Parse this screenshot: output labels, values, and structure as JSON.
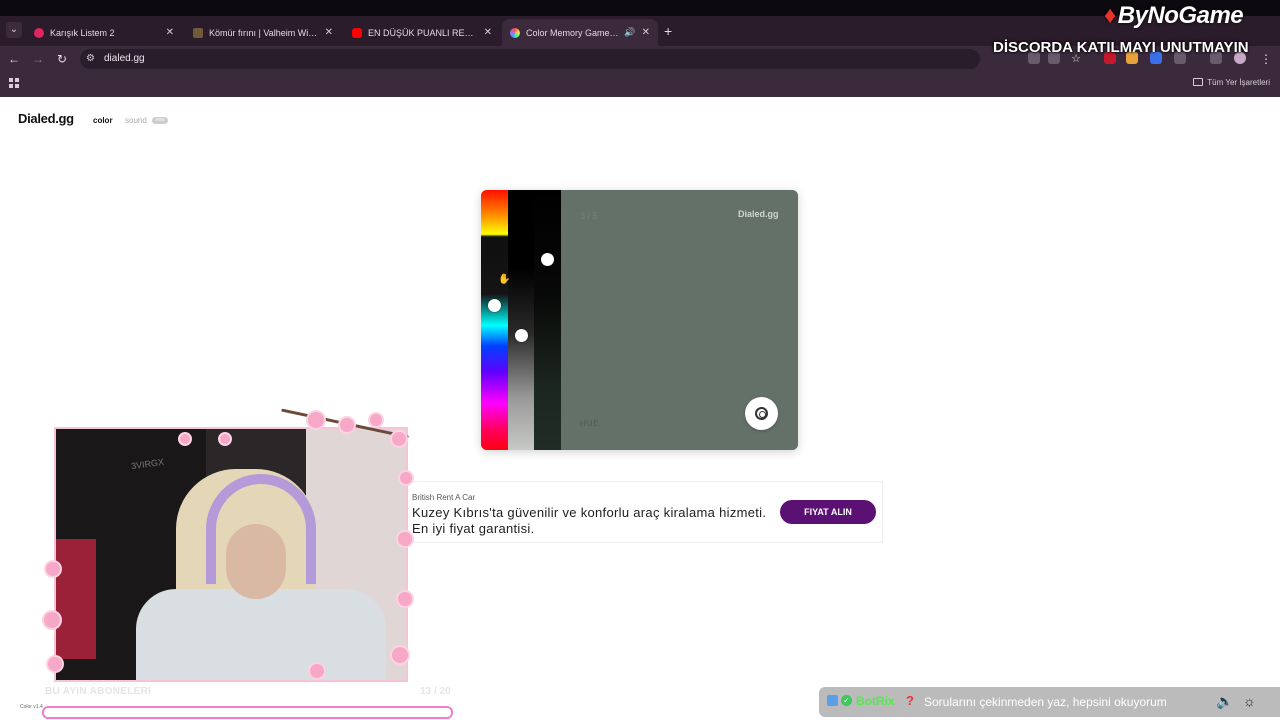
{
  "browser": {
    "tabs": [
      {
        "title": "Karışık Listem 2",
        "favicon_color": "#e0245e"
      },
      {
        "title": "Kömür fırını | Valheim Wiki | Hayranlar",
        "favicon_color": "#6f5a3a"
      },
      {
        "title": "EN DÜŞÜK PUANLI RESTORANI",
        "favicon_color": "#ff0000"
      },
      {
        "title": "Color Memory Game — Hayranlar",
        "favicon_color": "#b46be0"
      }
    ],
    "new_tab": "+",
    "address": "dialed.gg",
    "bookmarks_all": "Tüm Yer İşaretleri"
  },
  "overlay": {
    "logo": "ByNoGame",
    "banner": "DİSCORDA KATILMAYI UNUTMAYIN",
    "subs_label": "BU AYIN ABONELERI",
    "subs_count": "13 / 20",
    "ticker_bot": "BotRix",
    "ticker_message": "Sorularını çekinmeden yaz, hepsini okuyorum",
    "chair_brand": "3VIRGX"
  },
  "site": {
    "brand": "Dialed.gg",
    "nav_color": "color",
    "nav_sound": "sound",
    "new_badge": "new",
    "footer_version": "Color v1.4"
  },
  "game": {
    "round": "3 / 5",
    "card_logo": "Dialed.gg",
    "slider_label": "HUE",
    "current_color": "#647168"
  },
  "ad": {
    "source": "British Rent A Car",
    "text": "Kuzey Kıbrıs'ta güvenilir ve konforlu araç kiralama hizmeti. En iyi fiyat garantisi.",
    "button": "FIYAT ALIN"
  }
}
